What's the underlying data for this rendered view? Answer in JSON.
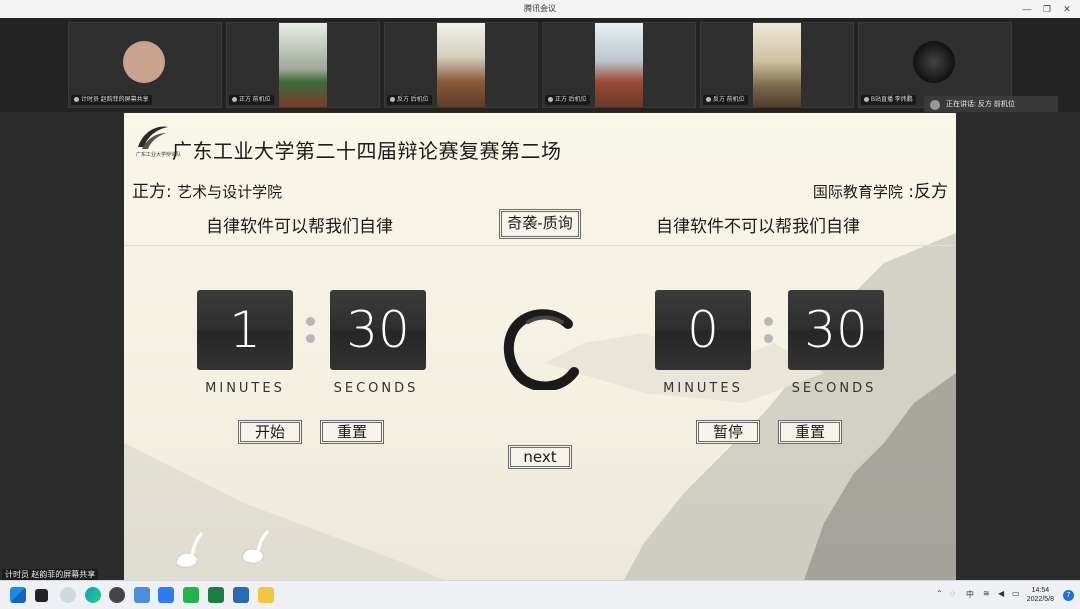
{
  "window": {
    "title": "腾讯会议"
  },
  "participants": [
    {
      "label": "计时员 赵韵菲的屏幕共享",
      "video": "#c9a38d",
      "icon": "screen-share-icon"
    },
    {
      "label": "正方 前机位",
      "video": "#7f8a7f",
      "icon": "mic-icon"
    },
    {
      "label": "反方 后机位",
      "video": "#a3856b",
      "icon": "mic-icon"
    },
    {
      "label": "正方 后机位",
      "video": "#9b8470",
      "icon": "mic-icon"
    },
    {
      "label": "反方 前机位",
      "video": "#8a8a6e",
      "icon": "mic-icon"
    },
    {
      "label": "B站直播 李炜鹏",
      "video": "#1b1b1b",
      "icon": "mic-icon"
    }
  ],
  "speaking": {
    "text": "正在讲话: 反方 前机位"
  },
  "slide": {
    "title": "广东工业大学第二十四届辩论赛复赛第二场",
    "logo_text": "广东工业大学辩论队",
    "pro_side": "正方:",
    "pro_school": "艺术与设计学院",
    "con_school": "国际教育学院",
    "con_side": ":反方",
    "pro_motion": "自律软件可以帮我们自律",
    "con_motion": "自律软件不可以帮我们自律",
    "stage_label": "奇袭-质询",
    "left_timer": {
      "minutes": "1",
      "seconds": "30"
    },
    "right_timer": {
      "minutes": "0",
      "seconds": "30"
    },
    "minutes_label": "MINUTES",
    "seconds_label": "SECONDS",
    "start_label": "开始",
    "reset_label": "重置",
    "pause_label": "暂停",
    "next_label": "next"
  },
  "overlay": {
    "share_note": "计时员 赵韵菲的屏幕共享"
  },
  "taskbar": {
    "ime": "中",
    "time": "14:54",
    "date": "2022/5/8",
    "notifications": "7"
  }
}
